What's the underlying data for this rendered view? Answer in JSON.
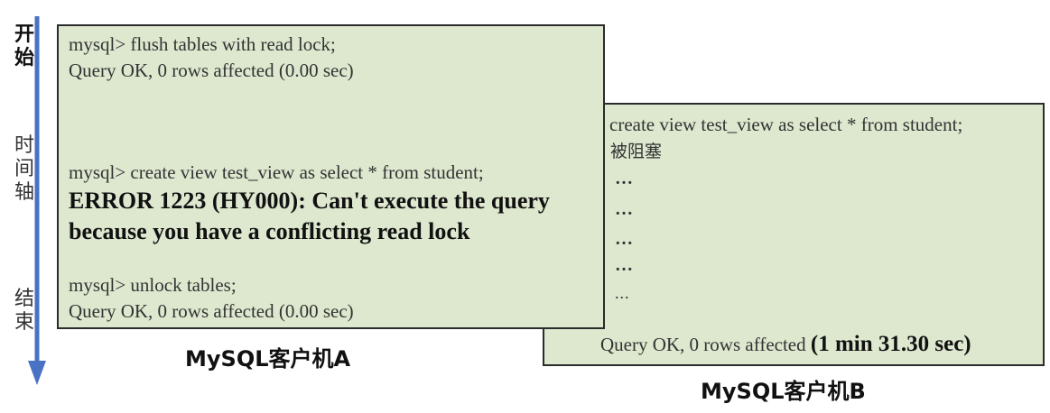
{
  "timeline": {
    "start_label": [
      "开",
      "始"
    ],
    "axis_label": [
      "时",
      "间",
      "轴"
    ],
    "end_label": [
      "结",
      "束"
    ]
  },
  "client_a": {
    "caption": "MySQL客户机A",
    "lines": {
      "cmd1": "mysql> flush tables with read lock;",
      "res1": "Query OK, 0 rows affected (0.00 sec)",
      "cmd2": "mysql> create view test_view as select * from student;",
      "err1": "ERROR 1223 (HY000): Can't execute the query",
      "err2": "because you have a conflicting read lock",
      "cmd3": "mysql> unlock tables;",
      "res3": "Query OK, 0 rows affected (0.00 sec)"
    }
  },
  "client_b": {
    "caption": "MySQL客户机B",
    "lines": {
      "cmd1": "create view test_view as select * from student;",
      "blocked": "被阻塞",
      "dots1": "…",
      "dots2": "…",
      "dots3": "…",
      "dots4": "…",
      "dots5": "...",
      "result_prefix": "Query OK, 0 rows affected ",
      "result_time": "(1 min 31.30 sec)"
    }
  },
  "colors": {
    "panel_fill": "#dde8cf",
    "arrow": "#4a72c4"
  }
}
